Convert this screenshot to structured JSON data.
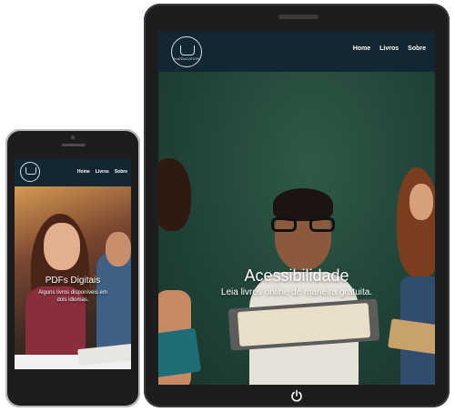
{
  "brand": {
    "logo_text": "ProEDUCATION",
    "nav_bg": "#132733"
  },
  "tablet": {
    "nav": {
      "home": "Home",
      "livros": "Livros",
      "sobre": "Sobre"
    },
    "hero": {
      "title": "Acessibilidade",
      "subtitle": "Leia livros online de maneira gratuita."
    },
    "power_icon": "power-icon"
  },
  "phone": {
    "nav": {
      "home": "Home",
      "livros": "Livros",
      "sobre": "Sobre"
    },
    "hero": {
      "title": "PDFs Digitais",
      "subtitle": "Alguns livros disponíveis em dois idiomas."
    }
  }
}
